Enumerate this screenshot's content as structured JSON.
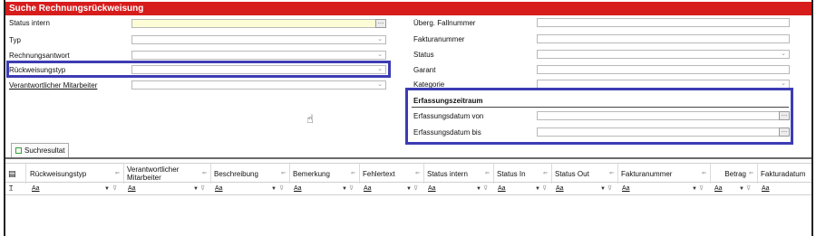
{
  "window": {
    "title": "Suche Rechnungsrückweisung"
  },
  "form": {
    "left": [
      {
        "label": "Status intern",
        "type": "text-lookup",
        "value": ""
      },
      {
        "label": "Typ",
        "type": "select",
        "value": ""
      },
      {
        "label": "Rechnungsantwort",
        "type": "select",
        "value": ""
      },
      {
        "label": "Rückweisungstyp",
        "type": "select",
        "value": ""
      },
      {
        "label": "Verantwortlicher Mitarbeiter",
        "type": "select",
        "value": ""
      }
    ],
    "right": [
      {
        "label": "Überg. Fallnummer",
        "type": "text",
        "value": ""
      },
      {
        "label": "Fakturanummer",
        "type": "text",
        "value": ""
      },
      {
        "label": "Status",
        "type": "select",
        "value": ""
      },
      {
        "label": "Garant",
        "type": "text",
        "value": ""
      },
      {
        "label": "Kategorie",
        "type": "select",
        "value": ""
      }
    ],
    "erfassungszeitraum": {
      "title": "Erfassungszeitraum",
      "von_label": "Erfassungsdatum von",
      "bis_label": "Erfassungsdatum bis",
      "von_value": "",
      "bis_value": ""
    }
  },
  "tabs": [
    {
      "label": "Suchresultat"
    }
  ],
  "grid": {
    "columns": [
      "Rückweisungstyp",
      "Verantwortlicher Mitarbeiter",
      "Beschreibung",
      "Bemerkung",
      "Fehlertext",
      "Status intern",
      "Status In",
      "Status Out",
      "Fakturanummer",
      "Betrag",
      "Fakturadatum"
    ],
    "filter_placeholder": "Aa"
  },
  "icons": {
    "dropdown": "chevron-down-icon",
    "lookup": "ellipsis-icon",
    "sort": "sort-icon",
    "filter": "filter-icon",
    "cursor": "hand-pointer-icon"
  },
  "colors": {
    "title_bar": "#d71c1c",
    "highlight": "#3c3cb4",
    "required_field": "#fcfcd6"
  }
}
